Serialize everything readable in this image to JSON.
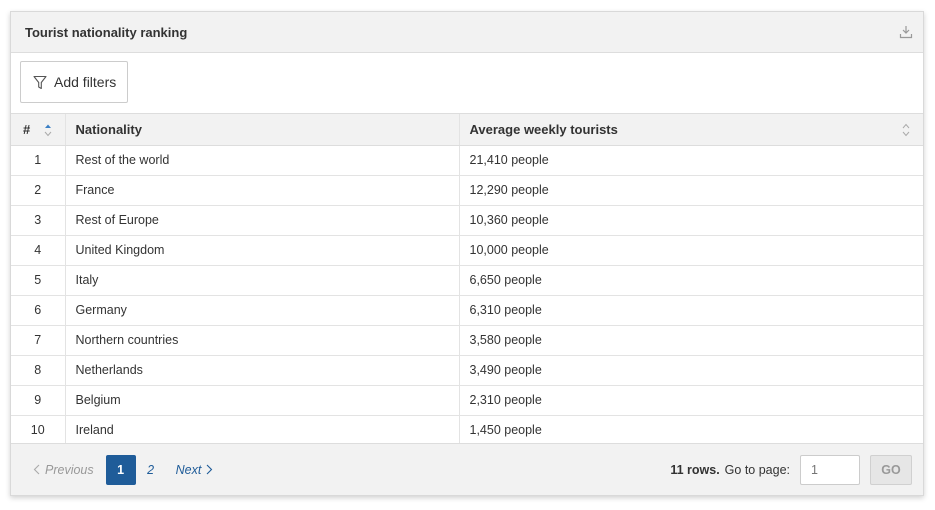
{
  "widget": {
    "title": "Tourist nationality ranking",
    "filter_label": "Add filters"
  },
  "table": {
    "columns": [
      "#",
      "Nationality",
      "Average weekly tourists"
    ],
    "rows": [
      {
        "rank": "1",
        "nationality": "Rest of the world",
        "tourists": "21,410 people"
      },
      {
        "rank": "2",
        "nationality": "France",
        "tourists": "12,290 people"
      },
      {
        "rank": "3",
        "nationality": "Rest of Europe",
        "tourists": "10,360 people"
      },
      {
        "rank": "4",
        "nationality": "United Kingdom",
        "tourists": "10,000 people"
      },
      {
        "rank": "5",
        "nationality": "Italy",
        "tourists": "6,650 people"
      },
      {
        "rank": "6",
        "nationality": "Germany",
        "tourists": "6,310 people"
      },
      {
        "rank": "7",
        "nationality": "Northern countries",
        "tourists": "3,580 people"
      },
      {
        "rank": "8",
        "nationality": "Netherlands",
        "tourists": "3,490 people"
      },
      {
        "rank": "9",
        "nationality": "Belgium",
        "tourists": "2,310 people"
      },
      {
        "rank": "10",
        "nationality": "Ireland",
        "tourists": "1,450 people"
      }
    ]
  },
  "pagination": {
    "previous_label": "Previous",
    "pages": [
      "1",
      "2"
    ],
    "current_page": "1",
    "next_label": "Next",
    "rows_count": "11 rows.",
    "goto_label": "Go to page:",
    "goto_placeholder": "1",
    "go_label": "GO"
  },
  "colors": {
    "accent": "#1f5c99",
    "sort_active": "#3b7fc4",
    "header_bg": "#f2f2f2"
  }
}
